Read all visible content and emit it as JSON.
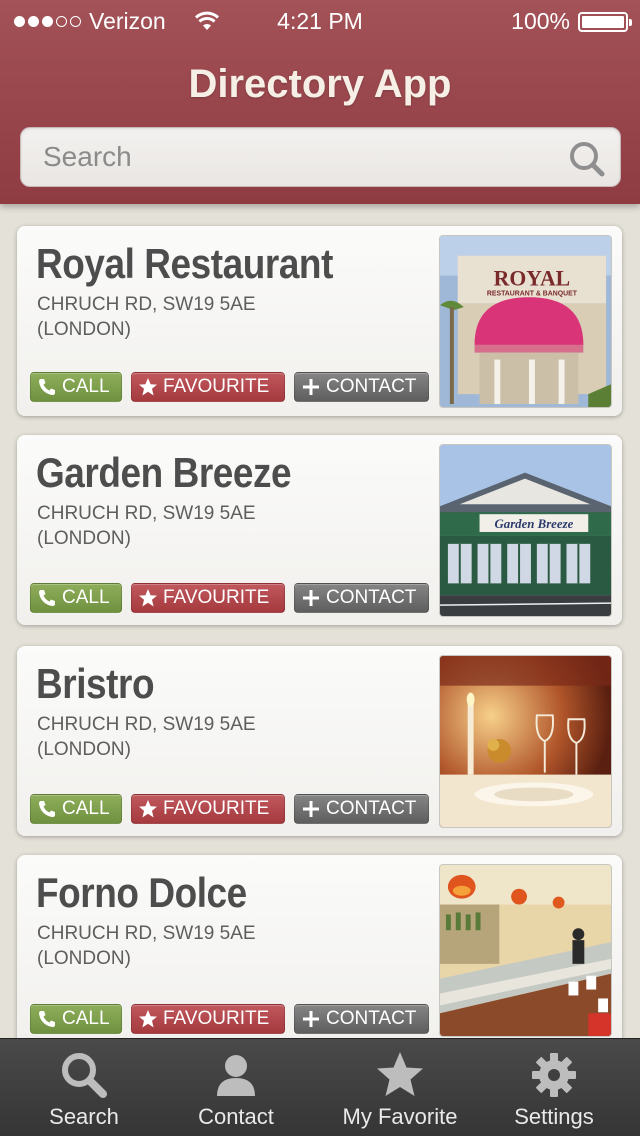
{
  "status_bar": {
    "carrier": "Verizon",
    "time": "4:21 PM",
    "battery": "100%",
    "signal_bars_filled": 3,
    "signal_bars_total": 5
  },
  "header": {
    "title": "Directory App",
    "search_placeholder": "Search"
  },
  "buttons": {
    "call": "CALL",
    "favourite": "FAVOURITE",
    "contact": "CONTACT"
  },
  "listings": [
    {
      "name": "Royal Restaurant",
      "address_line1": "CHRUCH RD, SW19 5AE",
      "address_line2": "(LONDON)",
      "photo": "royal-restaurant-storefront",
      "photo_sign": "ROYAL",
      "photo_subsign": "RESTAURANT & BANQUET"
    },
    {
      "name": "Garden Breeze",
      "address_line1": "CHRUCH RD, SW19 5AE",
      "address_line2": "(LONDON)",
      "photo": "garden-breeze-storefront",
      "photo_sign": "Garden Breeze"
    },
    {
      "name": "Bristro",
      "address_line1": "CHRUCH RD, SW19 5AE",
      "address_line2": "(LONDON)",
      "photo": "bistro-table-setting"
    },
    {
      "name": "Forno Dolce",
      "address_line1": "CHRUCH RD, SW19 5AE",
      "address_line2": "(LONDON)",
      "photo": "forno-dolce-interior"
    }
  ],
  "tabbar": {
    "tabs": [
      {
        "label": "Search",
        "icon": "magnifier-icon"
      },
      {
        "label": "Contact",
        "icon": "person-icon"
      },
      {
        "label": "My Favorite",
        "icon": "star-icon"
      },
      {
        "label": "Settings",
        "icon": "gear-icon"
      }
    ]
  },
  "colors": {
    "header": "#9a474d",
    "call_button": "#7c9e4b",
    "favourite_button": "#b3474c",
    "contact_button": "#6e6e6e",
    "tabbar": "#404040"
  }
}
